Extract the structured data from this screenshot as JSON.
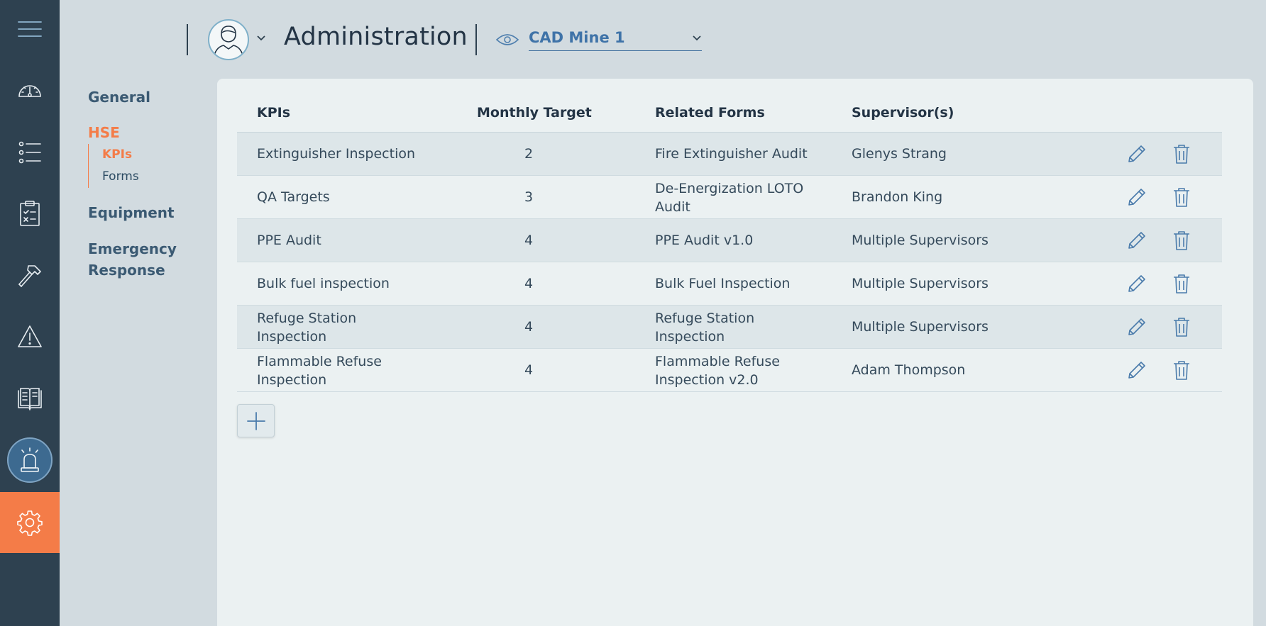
{
  "header": {
    "title": "Administration",
    "site": "CAD Mine 1"
  },
  "subnav": {
    "general": "General",
    "hse": "HSE",
    "hse_items": [
      "KPIs",
      "Forms"
    ],
    "equipment": "Equipment",
    "emergency": "Emergency Response"
  },
  "table": {
    "columns": [
      "KPIs",
      "Monthly Target",
      "Related Forms",
      "Supervisor(s)"
    ],
    "rows": [
      {
        "kpi": "Extinguisher Inspection",
        "target": "2",
        "form": "Fire Extinguisher Audit",
        "supervisor": "Glenys Strang"
      },
      {
        "kpi": "QA Targets",
        "target": "3",
        "form": "De-Energization LOTO Audit",
        "supervisor": "Brandon King"
      },
      {
        "kpi": "PPE Audit",
        "target": "4",
        "form": "PPE Audit v1.0",
        "supervisor": "Multiple Supervisors"
      },
      {
        "kpi": "Bulk fuel inspection",
        "target": "4",
        "form": "Bulk Fuel Inspection",
        "supervisor": "Multiple Supervisors"
      },
      {
        "kpi": "Refuge Station Inspection",
        "target": "4",
        "form": "Refuge Station Inspection",
        "supervisor": "Multiple Supervisors"
      },
      {
        "kpi": "Flammable Refuse Inspection",
        "target": "4",
        "form": "Flammable Refuse Inspection v2.0",
        "supervisor": "Adam Thompson"
      }
    ]
  },
  "icons": {
    "rail": [
      "menu-icon",
      "dashboard-icon",
      "checklist-icon",
      "clipboard-icon",
      "hammer-icon",
      "warning-icon",
      "manual-icon",
      "alarm-icon",
      "gear-icon"
    ],
    "row_actions": [
      "pencil-icon",
      "trash-icon"
    ],
    "add": "plus-icon"
  },
  "colors": {
    "rail": "#2e4150",
    "accent": "#f47c48",
    "link": "#3f73a8",
    "alarm_active": "#3d6a90"
  }
}
